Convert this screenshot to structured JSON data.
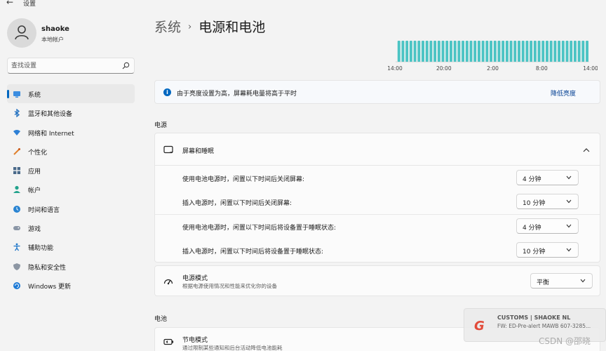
{
  "window": {
    "back_glyph": "←",
    "title": "设置"
  },
  "profile": {
    "name": "shaoke",
    "account_type": "本地帐户"
  },
  "search": {
    "placeholder": "查找设置"
  },
  "nav": [
    {
      "label": "系统",
      "icon": "system-icon",
      "active": true
    },
    {
      "label": "蓝牙和其他设备",
      "icon": "bluetooth-icon"
    },
    {
      "label": "网络和 Internet",
      "icon": "wifi-icon"
    },
    {
      "label": "个性化",
      "icon": "brush-icon"
    },
    {
      "label": "应用",
      "icon": "apps-icon"
    },
    {
      "label": "帐户",
      "icon": "account-icon"
    },
    {
      "label": "时间和语言",
      "icon": "globe-clock-icon"
    },
    {
      "label": "游戏",
      "icon": "gamepad-icon"
    },
    {
      "label": "辅助功能",
      "icon": "accessibility-icon"
    },
    {
      "label": "隐私和安全性",
      "icon": "shield-icon"
    },
    {
      "label": "Windows 更新",
      "icon": "update-icon"
    }
  ],
  "breadcrumb": {
    "parent": "系统",
    "separator": "›",
    "current": "电源和电池"
  },
  "battery_chart": {
    "x_labels": [
      "14:00",
      "20:00",
      "2:00",
      "8:00",
      "14:00"
    ],
    "bar_count": 48,
    "bar_color": "#4cc4c4"
  },
  "banner": {
    "message": "由于亮度设置为高，屏幕耗电量将高于平时",
    "action": "降低亮度"
  },
  "power_section": {
    "title": "电源"
  },
  "screen_sleep": {
    "title": "屏幕和睡眠",
    "rows": [
      {
        "label": "使用电池电源时，闲置以下时间后关闭屏幕:",
        "value": "4 分钟"
      },
      {
        "label": "插入电源时，闲置以下时间后关闭屏幕:",
        "value": "10 分钟"
      },
      {
        "label": "使用电池电源时，闲置以下时间后将设备置于睡眠状态:",
        "value": "4 分钟"
      },
      {
        "label": "插入电源时，闲置以下时间后将设备置于睡眠状态:",
        "value": "10 分钟"
      }
    ]
  },
  "power_mode": {
    "title": "电源模式",
    "subtitle": "根据电源使用情况和性能来优化你的设备",
    "value": "平衡"
  },
  "battery_section": {
    "title": "电池"
  },
  "battery_saver": {
    "title": "节电模式",
    "subtitle": "通过限制某些通知和后台活动降低电池能耗"
  },
  "watermark": {
    "title": "CUSTOMS | SHAOKE NL",
    "subtitle": "FW: ED-Pre-alert MAWB 607-3285...",
    "source": "CSDN @邵晓"
  },
  "colors": {
    "accent": "#0067c0",
    "link": "#003e92",
    "chart_bar": "#4cc4c4"
  }
}
